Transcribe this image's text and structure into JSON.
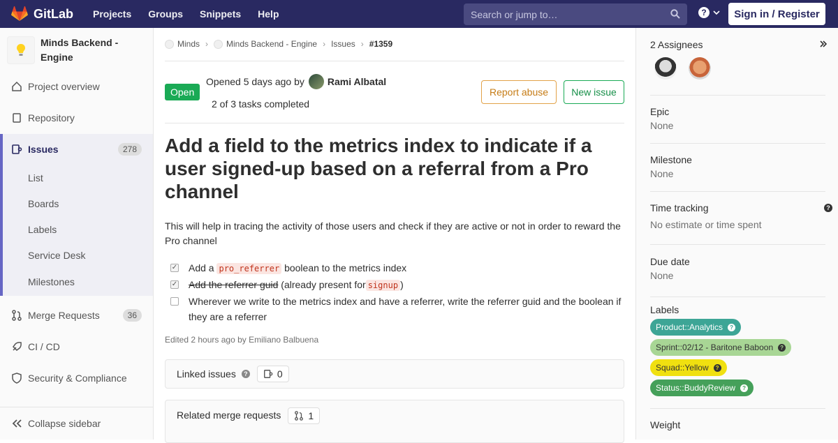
{
  "topnav": {
    "brand": "GitLab",
    "links": [
      "Projects",
      "Groups",
      "Snippets",
      "Help"
    ],
    "search_placeholder": "Search or jump to…",
    "signin": "Sign in / Register"
  },
  "sidebar": {
    "project_name": "Minds Backend - Engine",
    "items": [
      {
        "label": "Project overview"
      },
      {
        "label": "Repository"
      },
      {
        "label": "Issues",
        "count": "278"
      },
      {
        "label": "Merge Requests",
        "count": "36"
      },
      {
        "label": "CI / CD"
      },
      {
        "label": "Security & Compliance"
      }
    ],
    "subitems": [
      "List",
      "Boards",
      "Labels",
      "Service Desk",
      "Milestones"
    ],
    "collapse": "Collapse sidebar"
  },
  "breadcrumb": [
    "Minds",
    "Minds Backend - Engine",
    "Issues",
    "#1359"
  ],
  "issue": {
    "status": "Open",
    "opened_prefix": "Opened 5 days ago by",
    "author": "Rami Albatal",
    "tasks": "2 of 3 tasks completed",
    "report_abuse": "Report abuse",
    "new_issue": "New issue",
    "title": "Add a field to the metrics index to indicate if a user signed-up based on a referral from a Pro channel",
    "description": "This will help in tracing the activity of those users and check if they are active or not in order to reward the Pro channel",
    "task1_a": "Add a",
    "task1_code": "pro_referrer",
    "task1_b": "boolean to the metrics index",
    "task2_strike": "Add the referrer guid",
    "task2_b": "(already present for",
    "task2_code": "signup",
    "task2_c": ")",
    "task3": "Wherever we write to the metrics index and have a referrer, write the referrer guid and the boolean if they are a referrer",
    "edited": "Edited 2 hours ago by Emiliano Balbuena",
    "linked_issues": "Linked issues",
    "linked_count": "0",
    "related_mr": "Related merge requests",
    "related_count": "1"
  },
  "right": {
    "assignees": "2 Assignees",
    "epic": "Epic",
    "epic_val": "None",
    "milestone": "Milestone",
    "milestone_val": "None",
    "time": "Time tracking",
    "time_val": "No estimate or time spent",
    "due": "Due date",
    "due_val": "None",
    "labels_title": "Labels",
    "labels": [
      {
        "text": "Product::Analytics",
        "color": "#3da596"
      },
      {
        "text": "Sprint::02/12 - Baritone Baboon",
        "color": "#a8d695"
      },
      {
        "text": "Squad::Yellow",
        "color": "#f0e010"
      },
      {
        "text": "Status::BuddyReview",
        "color": "#45a05a"
      }
    ],
    "weight": "Weight"
  }
}
